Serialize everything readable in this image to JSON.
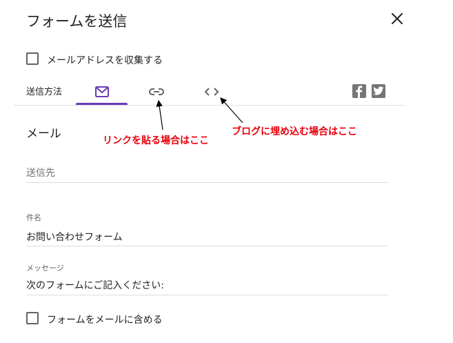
{
  "dialog": {
    "title": "フォームを送信",
    "close_icon": "close-icon"
  },
  "collect_email": {
    "label": "メールアドレスを収集する",
    "checked": false
  },
  "send_via": {
    "label": "送信方法",
    "tabs": [
      {
        "icon": "mail-icon",
        "active": true
      },
      {
        "icon": "link-icon",
        "active": false
      },
      {
        "icon": "embed-code-icon",
        "active": false
      }
    ],
    "social": [
      {
        "icon": "facebook-icon"
      },
      {
        "icon": "twitter-icon"
      }
    ],
    "accent_color": "#673ab7"
  },
  "email_form": {
    "section_title": "メール",
    "to": {
      "placeholder": "送信先",
      "value": ""
    },
    "subject": {
      "label": "件名",
      "value": "お問い合わせフォーム"
    },
    "message": {
      "label": "メッセージ",
      "value": "次のフォームにご記入ください:"
    },
    "include_form": {
      "label": "フォームをメールに含める",
      "checked": false
    }
  },
  "annotations": [
    {
      "text": "リンクを貼る場合はここ",
      "color": "#e8000b"
    },
    {
      "text": "ブログに埋め込む場合はここ",
      "color": "#e8000b"
    }
  ]
}
